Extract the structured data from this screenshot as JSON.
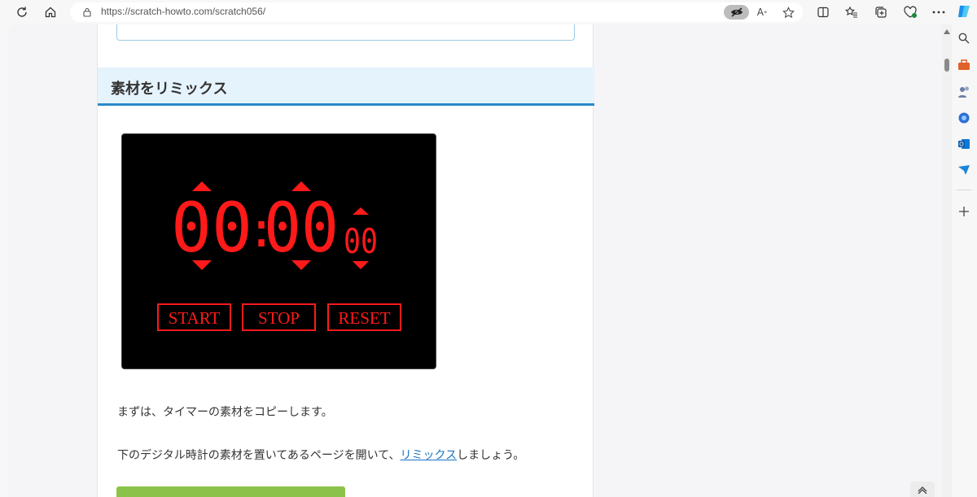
{
  "browser": {
    "url": "https://scratch-howto.com/scratch056/"
  },
  "article": {
    "heading": "素材をリミックス",
    "timer": {
      "minutes": "00",
      "colon": ":",
      "seconds": "00",
      "centiseconds": "00",
      "buttons": [
        "START",
        "STOP",
        "RESET"
      ]
    },
    "para1": "まずは、タイマーの素材をコピーします。",
    "para2_before": "下のデジタル時計の素材を置いてあるページを開いて、",
    "para2_link": "リミックス",
    "para2_after": "しましょう。"
  },
  "colors": {
    "heading_bg": "#e5f3fd",
    "heading_border": "#2b8ac9",
    "timer_red": "#ff1a1a",
    "link": "#1a73c4",
    "green_button": "#8bc34a"
  }
}
